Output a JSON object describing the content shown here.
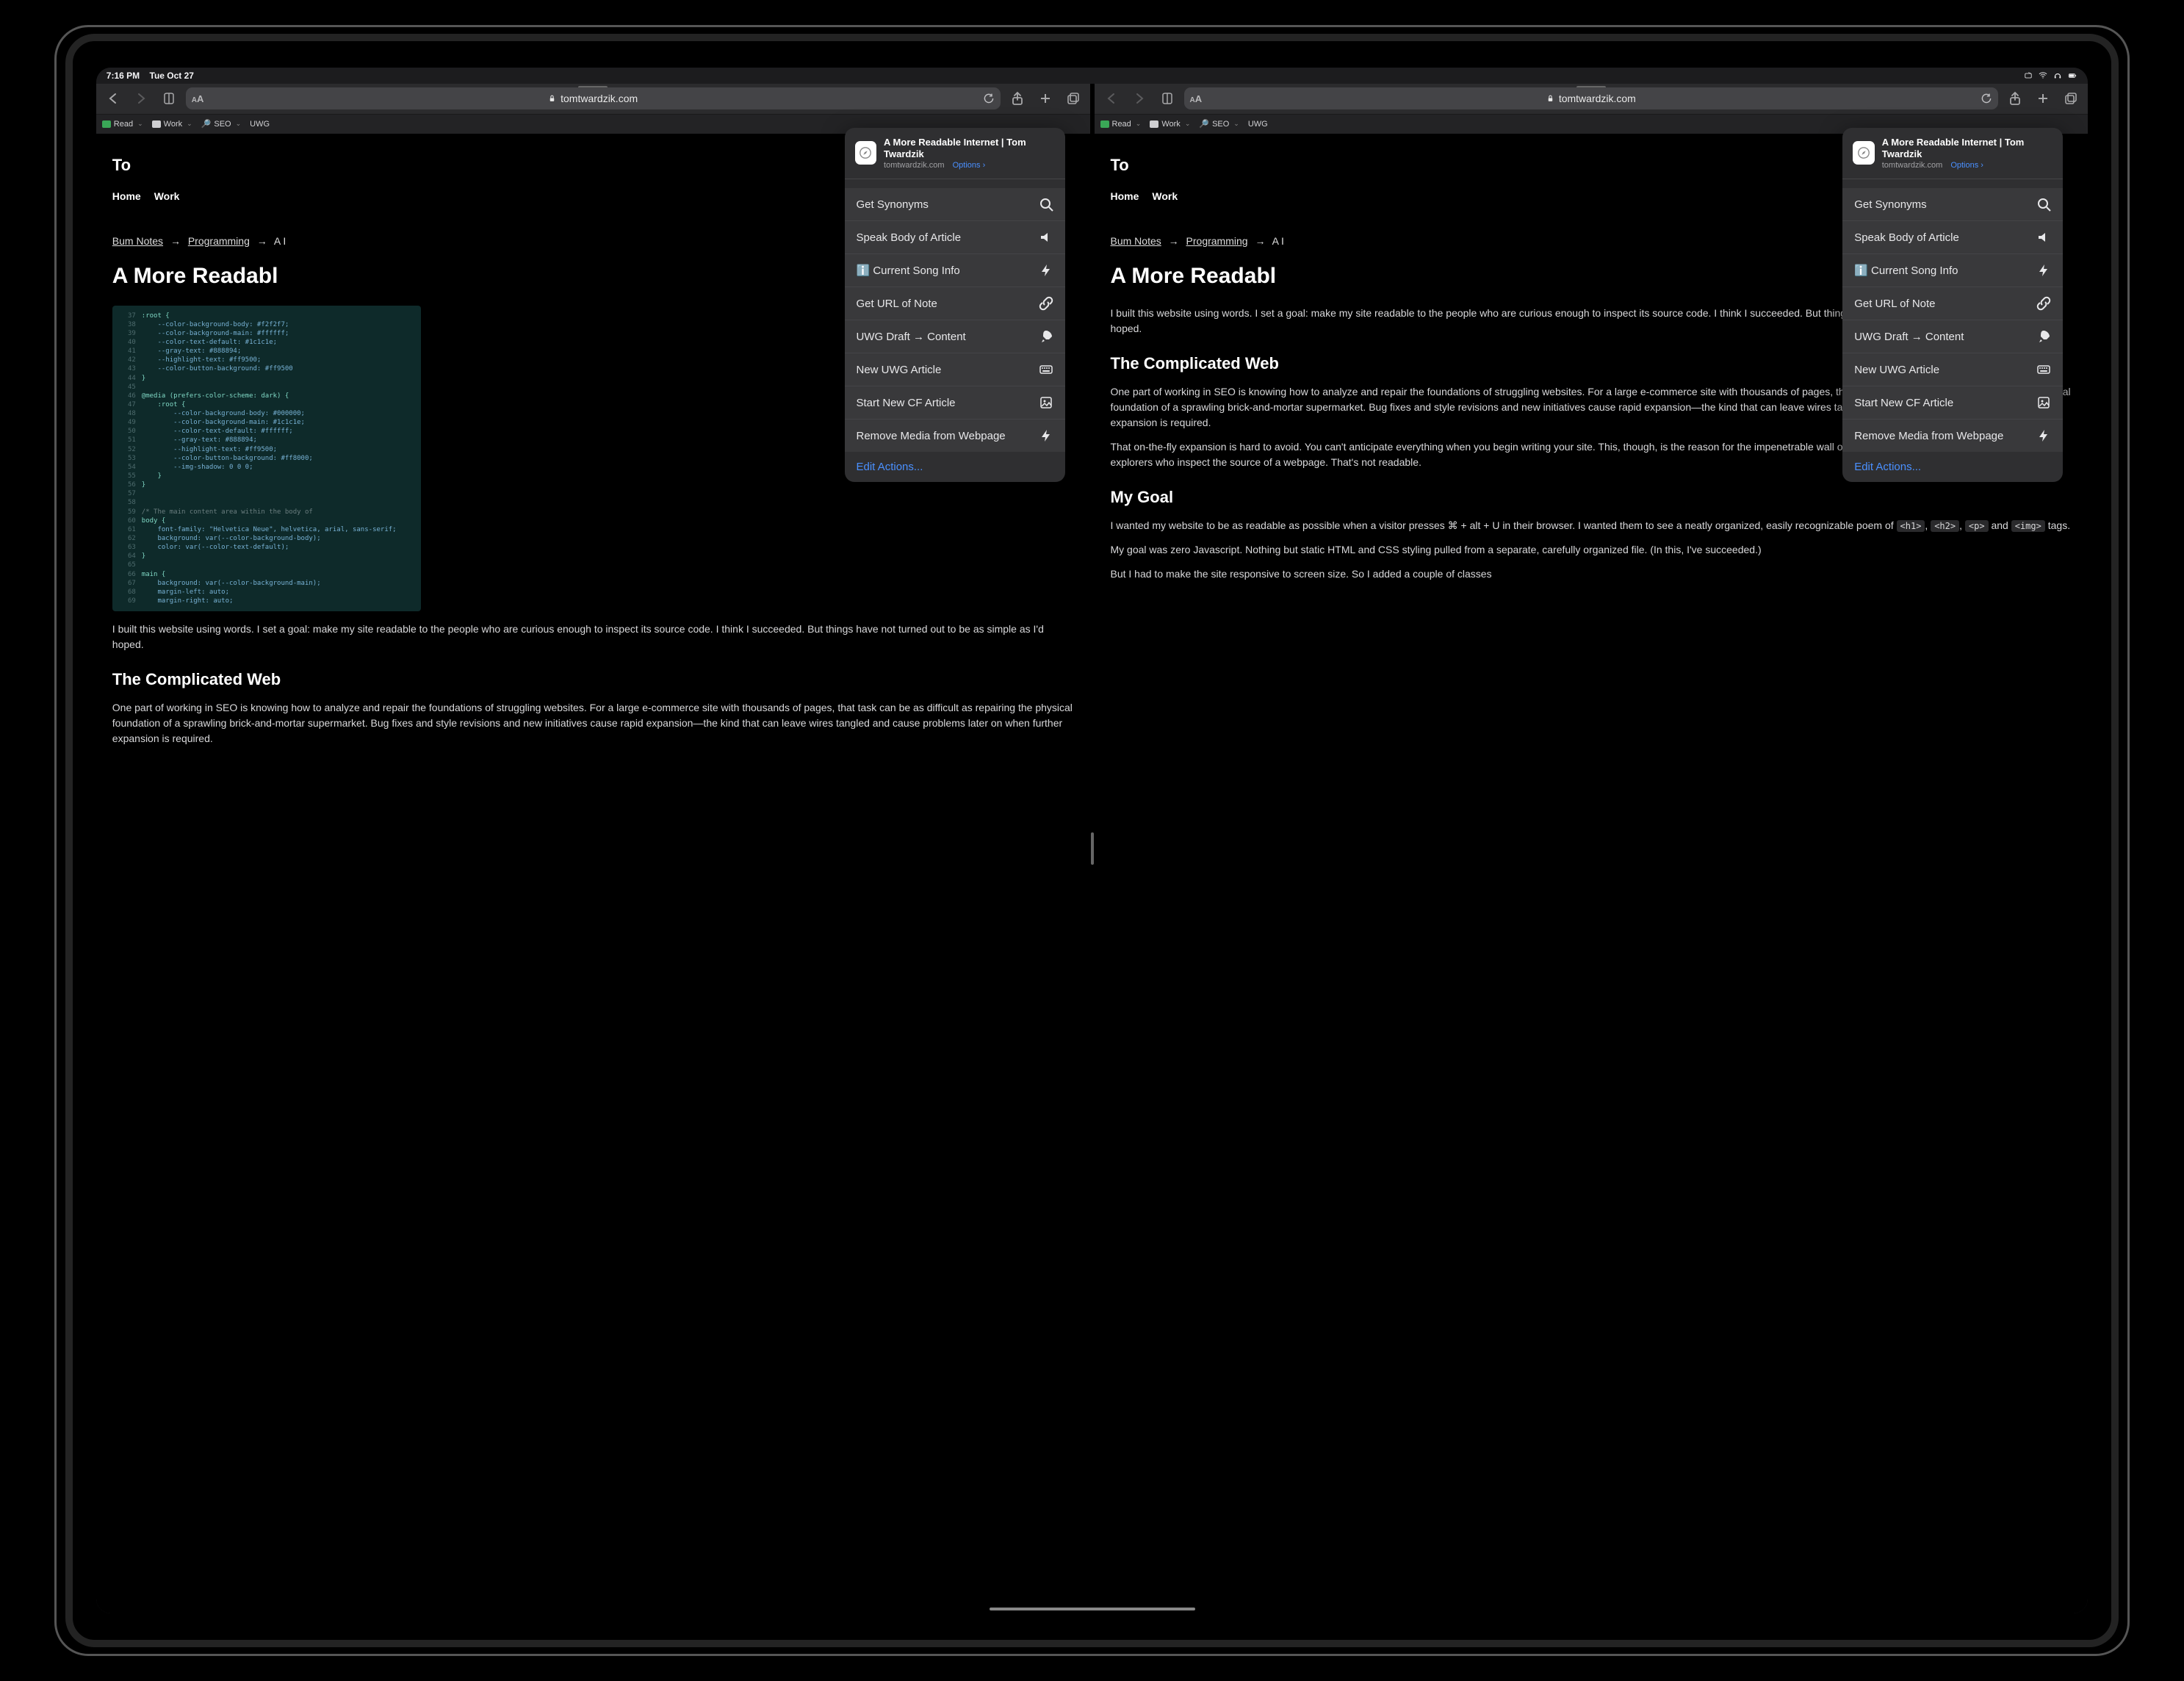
{
  "status": {
    "time": "7:16 PM",
    "date": "Tue Oct 27"
  },
  "toolbar": {
    "url": "tomtwardzik.com"
  },
  "favorites": [
    {
      "label": "Read",
      "color": "#3aa757"
    },
    {
      "label": "Work",
      "color": "#cfcfd2"
    },
    {
      "label": "SEO",
      "color": "#8e8e93"
    },
    {
      "label": "UWG",
      "color": null
    }
  ],
  "share": {
    "title": "A More Readable Internet | Tom Twardzik",
    "domain": "tomtwardzik.com",
    "options_label": "Options",
    "actions": [
      {
        "label": "Get Synonyms",
        "icon": "search"
      },
      {
        "label": "Speak Body of Article",
        "icon": "speaker"
      },
      {
        "label": "ℹ️ Current Song Info",
        "icon": "bolt"
      },
      {
        "label": "Get URL of Note",
        "icon": "link"
      },
      {
        "label": "UWG Draft → Content",
        "icon": "rocket"
      },
      {
        "label": "New UWG Article",
        "icon": "keyboard"
      },
      {
        "label": "Start New CF Article",
        "icon": "picture"
      },
      {
        "label": "Remove Media from Webpage",
        "icon": "bolt"
      }
    ],
    "edit_label": "Edit Actions..."
  },
  "page": {
    "site_title_left": "To",
    "site_title_right": "To",
    "nav": [
      "Home",
      "Work"
    ],
    "crumbs": {
      "a": "Bum Notes",
      "b": "Programming",
      "c": "A I"
    },
    "h1": "A More Readabl",
    "para_intro": "I built this website using words. I set a goal: make my site readable to the people who are curious enough to inspect its source code. I think I succeeded. But things have not turned out to be as simple as I'd hoped.",
    "para_intro_r": "I built this website using words. I set a goal: make my site readable to the people who are curious enough to inspect its source code. I think I succeeded. But things have not turned out to be as simple as I'd hoped.",
    "h2a": "The Complicated Web",
    "para_comp": "One part of working in SEO is knowing how to analyze and repair the foundations of struggling websites. For a large e-commerce site with thousands of pages, that task can be as difficult as repairing the physical foundation of a sprawling brick-and-mortar supermarket. Bug fixes and style revisions and new initiatives cause rapid expansion—the kind that can leave wires tangled and cause problems later on when further expansion is required.",
    "para_fly": "That on-the-fly expansion is hard to avoid. You can't anticipate everything when you begin writing your site. This, though, is the reason for the impenetrable wall of <div> tags and lines of CSS that often greets explorers who inspect the source of a webpage. That's not readable.",
    "h2_goal": "My Goal",
    "para_goal1": "I wanted my website to be as readable as possible when a visitor presses ⌘ + alt + U in their browser. I wanted them to see a neatly organized, easily recognizable poem of <h1>, <h2>, <p> and <img> tags.",
    "para_goal2": "My goal was zero Javascript. Nothing but static HTML and CSS styling pulled from a separate, carefully organized file. (In this, I've succeeded.)",
    "para_goal3": "But I had to make the site responsive to screen size. So I added a couple of classes"
  },
  "code": [
    {
      "n": "37",
      "t": ":root {",
      "c": "kw"
    },
    {
      "n": "38",
      "t": "    --color-background-body: #f2f2f7;",
      "c": "prop"
    },
    {
      "n": "39",
      "t": "    --color-background-main: #ffffff;",
      "c": "prop"
    },
    {
      "n": "40",
      "t": "    --color-text-default: #1c1c1e;",
      "c": "prop"
    },
    {
      "n": "41",
      "t": "    --gray-text: #888894;",
      "c": "prop"
    },
    {
      "n": "42",
      "t": "    --highlight-text: #ff9500;",
      "c": "prop"
    },
    {
      "n": "43",
      "t": "    --color-button-background: #ff9500",
      "c": "prop"
    },
    {
      "n": "44",
      "t": "}",
      "c": "kw"
    },
    {
      "n": "45",
      "t": "",
      "c": ""
    },
    {
      "n": "46",
      "t": "@media (prefers-color-scheme: dark) {",
      "c": "kw"
    },
    {
      "n": "47",
      "t": "    :root {",
      "c": "kw"
    },
    {
      "n": "48",
      "t": "        --color-background-body: #000000;",
      "c": "prop"
    },
    {
      "n": "49",
      "t": "        --color-background-main: #1c1c1e;",
      "c": "prop"
    },
    {
      "n": "50",
      "t": "        --color-text-default: #ffffff;",
      "c": "prop"
    },
    {
      "n": "51",
      "t": "        --gray-text: #888894;",
      "c": "prop"
    },
    {
      "n": "52",
      "t": "        --highlight-text: #ff9500;",
      "c": "prop"
    },
    {
      "n": "53",
      "t": "        --color-button-background: #ff8000;",
      "c": "prop"
    },
    {
      "n": "54",
      "t": "        --img-shadow: 0 0 0;",
      "c": "prop"
    },
    {
      "n": "55",
      "t": "    }",
      "c": "kw"
    },
    {
      "n": "56",
      "t": "}",
      "c": "kw"
    },
    {
      "n": "57",
      "t": "",
      "c": ""
    },
    {
      "n": "58",
      "t": "",
      "c": ""
    },
    {
      "n": "59",
      "t": "/* The main content area within the body of",
      "c": "cm"
    },
    {
      "n": "60",
      "t": "body {",
      "c": "kw"
    },
    {
      "n": "61",
      "t": "    font-family: \"Helvetica Neue\", helvetica, arial, sans-serif;",
      "c": "prop"
    },
    {
      "n": "62",
      "t": "    background: var(--color-background-body);",
      "c": "prop"
    },
    {
      "n": "63",
      "t": "    color: var(--color-text-default);",
      "c": "prop"
    },
    {
      "n": "64",
      "t": "}",
      "c": "kw"
    },
    {
      "n": "65",
      "t": "",
      "c": ""
    },
    {
      "n": "66",
      "t": "main {",
      "c": "kw"
    },
    {
      "n": "67",
      "t": "    background: var(--color-background-main);",
      "c": "prop"
    },
    {
      "n": "68",
      "t": "    margin-left: auto;",
      "c": "prop"
    },
    {
      "n": "69",
      "t": "    margin-right: auto;",
      "c": "prop"
    }
  ]
}
